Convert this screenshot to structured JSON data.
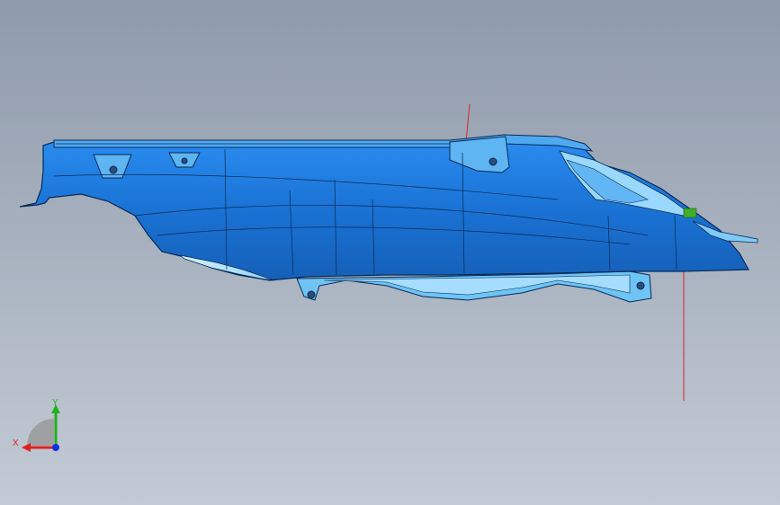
{
  "viewport": {
    "background_top": "#8f9aab",
    "background_bottom": "#c3cad5"
  },
  "model": {
    "part_color": "#1e7fe0",
    "edge_color": "#062a55",
    "highlight_color": "#bfe6ff",
    "marker_color": "#3fae2a",
    "axis_line_color": "#e0202a"
  },
  "triad": {
    "x_label": "X",
    "y_label": "Y",
    "x_color": "#e02020",
    "y_color": "#20b020",
    "z_color": "#1030e0"
  }
}
